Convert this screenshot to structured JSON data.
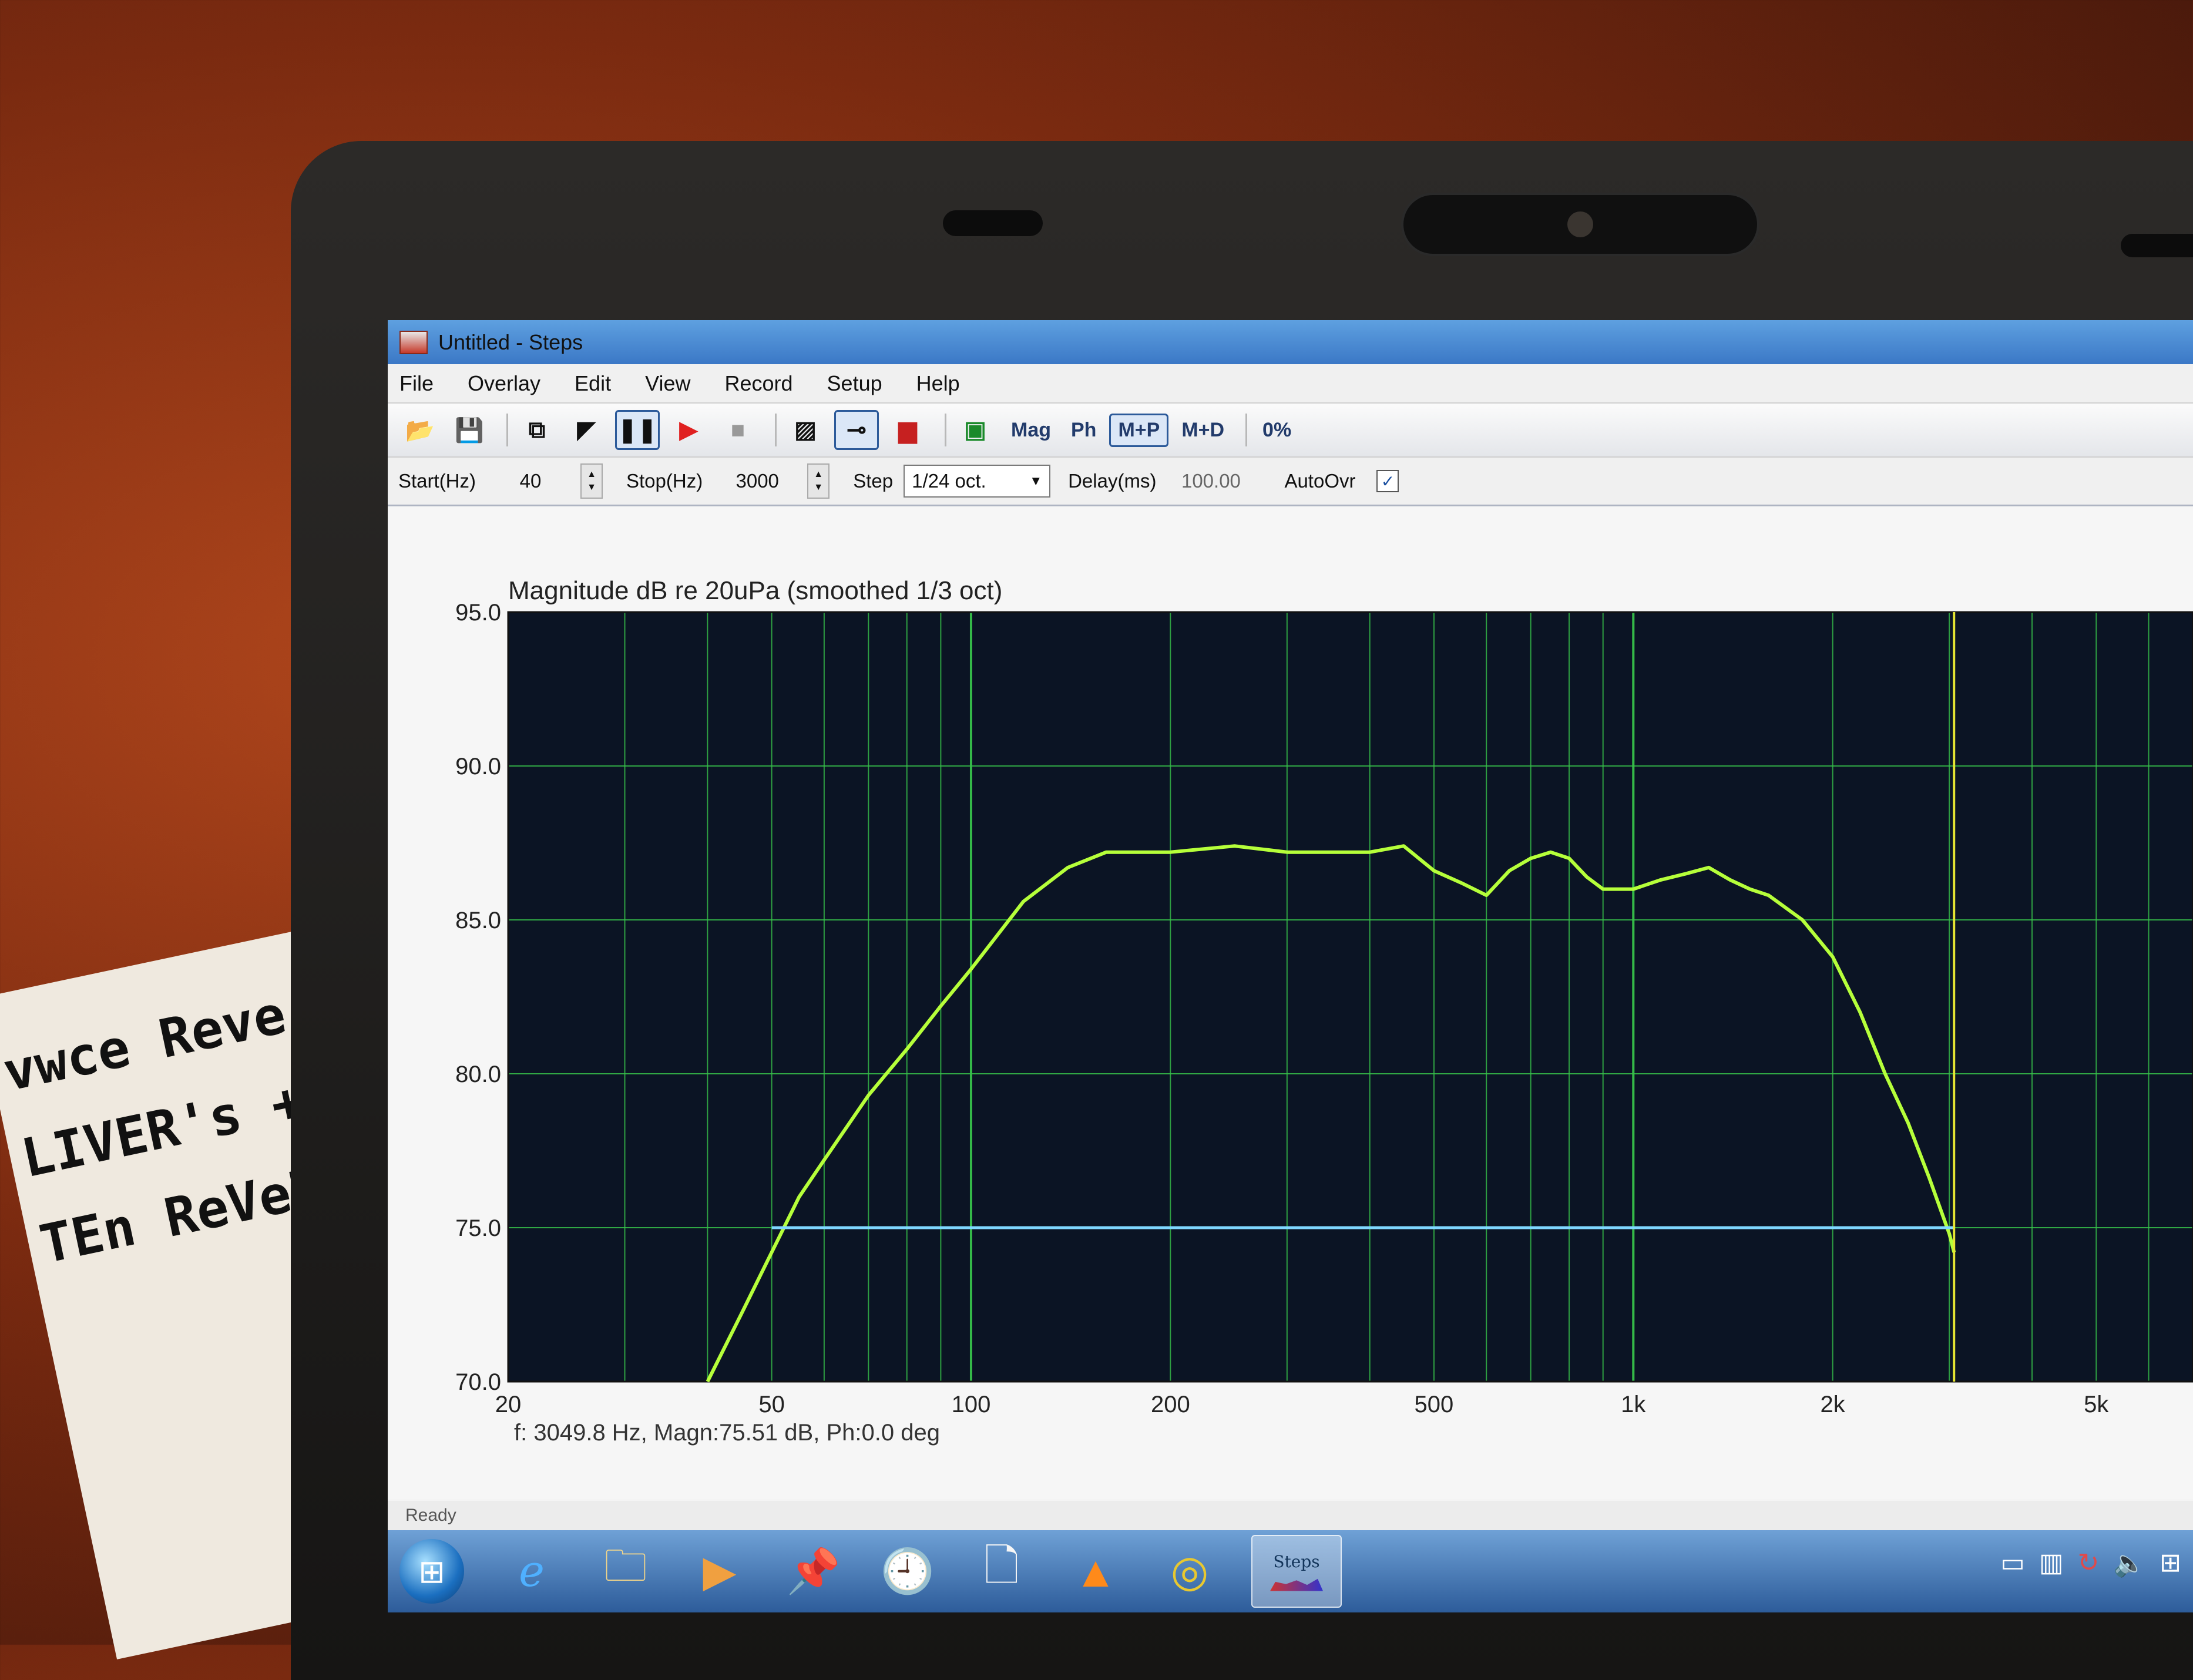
{
  "paper_note": {
    "lines": [
      "vwce Reve",
      "LIVER's +U",
      "TEn ReVeR"
    ]
  },
  "window": {
    "title": "Untitled - Steps"
  },
  "menu": [
    "File",
    "Overlay",
    "Edit",
    "View",
    "Record",
    "Setup",
    "Help"
  ],
  "toolbar": {
    "mag_label": "Mag",
    "ph_label": "Ph",
    "mp_label": "M+P",
    "md_label": "M+D",
    "percent_label": "0%"
  },
  "params": {
    "start_label": "Start(Hz)",
    "start_value": "40",
    "stop_label": "Stop(Hz)",
    "stop_value": "3000",
    "step_label": "Step",
    "step_value": "1/24 oct.",
    "delay_label": "Delay(ms)",
    "delay_value": "100.00",
    "autoovr_label": "AutoOvr",
    "autoovr_checked": "✓"
  },
  "chart_data": {
    "type": "line",
    "title": "Magnitude dB re 20uPa (smoothed  1/3 oct)",
    "x_scale": "log",
    "xlim": [
      20,
      7000
    ],
    "ylim": [
      70,
      95
    ],
    "x_tick_labels": [
      {
        "value": 20,
        "label": "20"
      },
      {
        "value": 50,
        "label": "50"
      },
      {
        "value": 100,
        "label": "100"
      },
      {
        "value": 200,
        "label": "200"
      },
      {
        "value": 500,
        "label": "500"
      },
      {
        "value": 1000,
        "label": "1k"
      },
      {
        "value": 2000,
        "label": "2k"
      },
      {
        "value": 5000,
        "label": "5k"
      }
    ],
    "y_tick_labels": [
      "95.0",
      "90.0",
      "85.0",
      "80.0",
      "75.0",
      "70.0"
    ],
    "grid": true,
    "background": "#0b1424",
    "grid_color": "#37c24a",
    "series": [
      {
        "color": "#b6ff3a",
        "x": [
          40,
          45,
          50,
          55,
          60,
          70,
          80,
          90,
          100,
          120,
          140,
          160,
          180,
          200,
          250,
          300,
          350,
          400,
          450,
          500,
          550,
          600,
          650,
          700,
          750,
          800,
          850,
          900,
          1000,
          1100,
          1200,
          1300,
          1400,
          1500,
          1600,
          1800,
          2000,
          2200,
          2400,
          2600,
          2800,
          3000,
          3050
        ],
        "y": [
          70.0,
          72.2,
          74.2,
          76.0,
          77.2,
          79.3,
          80.8,
          82.2,
          83.4,
          85.6,
          86.7,
          87.2,
          87.2,
          87.2,
          87.4,
          87.2,
          87.2,
          87.2,
          87.4,
          86.6,
          86.2,
          85.8,
          86.6,
          87.0,
          87.2,
          87.0,
          86.4,
          86.0,
          86.0,
          86.3,
          86.5,
          86.7,
          86.3,
          86.0,
          85.8,
          85.0,
          83.8,
          82.0,
          80.0,
          78.4,
          76.6,
          74.8,
          74.2
        ]
      },
      {
        "color": "#7fd7ff",
        "x": [
          50,
          3050
        ],
        "y": [
          75.0,
          75.0
        ]
      }
    ],
    "cursor": {
      "x": 3049.8,
      "color": "#e6e633"
    },
    "readout": "f: 3049.8 Hz, Magn:75.51 dB, Ph:0.0 deg"
  },
  "status": {
    "text": "Ready"
  },
  "taskbar": {
    "steps_label": "Steps"
  }
}
